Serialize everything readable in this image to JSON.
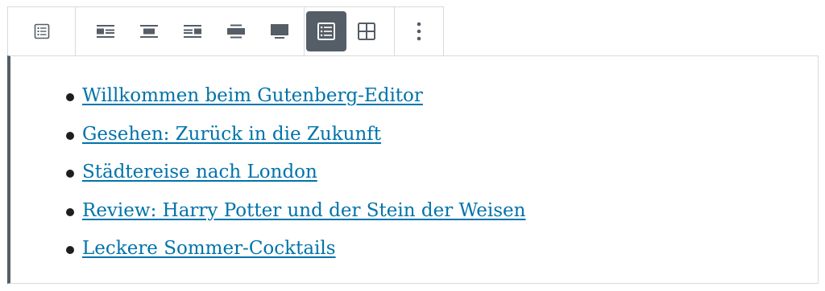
{
  "toolbar": {
    "block_type_icon": "list-icon",
    "alignment_icons": [
      "align-left-icon",
      "align-center-icon",
      "align-right-icon",
      "align-wide-icon",
      "align-full-icon"
    ],
    "view_icons": [
      "list-view-icon",
      "grid-view-icon"
    ],
    "active_view": "list-view-icon",
    "more_icon": "more-vertical-icon",
    "colors": {
      "icon": "#555d66",
      "active_bg": "#555d66",
      "active_icon": "#ffffff",
      "border": "#d8dadd"
    }
  },
  "latest_posts": {
    "items": [
      {
        "label": "Willkommen beim Gutenberg-Editor"
      },
      {
        "label": "Gesehen: Zurück in die Zukunft"
      },
      {
        "label": "Städtereise nach London"
      },
      {
        "label": "Review: Harry Potter und der Stein der Weisen"
      },
      {
        "label": "Leckere Sommer-Cocktails"
      }
    ],
    "colors": {
      "link": "#0073aa",
      "block_border_left": "#555d66"
    }
  }
}
